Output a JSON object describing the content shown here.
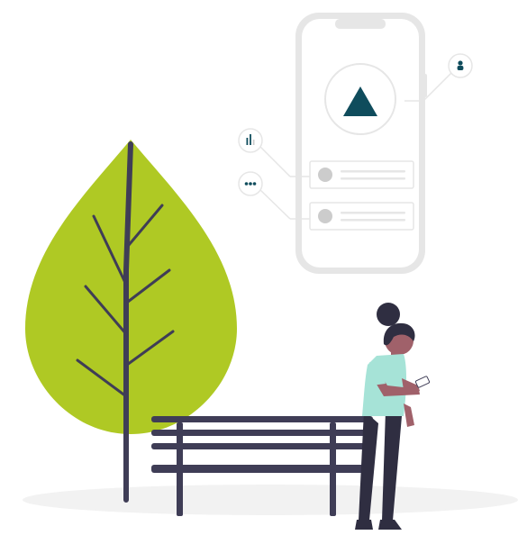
{
  "colors": {
    "background": "#ffffff",
    "ground": "#f2f2f2",
    "phone_frame": "#e6e6e6",
    "phone_screen": "#ffffff",
    "accent": "#0f4c5c",
    "leaf": "#afc924",
    "trunk": "#3f3d56",
    "bench": "#3f3d56",
    "placeholder": "#cccccc",
    "line": "#cccccc",
    "shirt": "#a6e3d7",
    "skin": "#a0616a",
    "hair": "#2f2e41",
    "pants": "#2f2e41"
  },
  "icons": {
    "main": "triangle-play-icon",
    "profile": "user-icon",
    "stats": "bar-chart-icon",
    "more": "more-dots-icon"
  }
}
